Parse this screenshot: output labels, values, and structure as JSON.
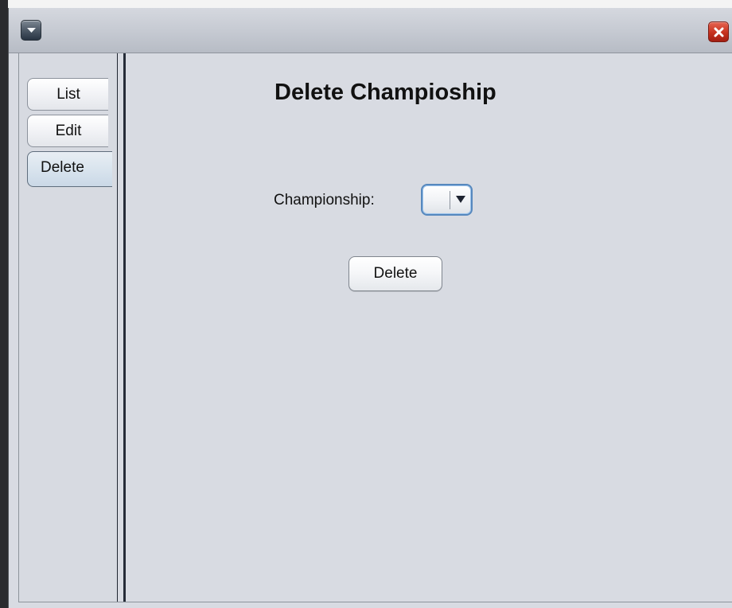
{
  "window": {
    "menu_icon": "chevron-down-icon",
    "close_icon": "close-icon"
  },
  "tabs": [
    {
      "label": "List",
      "selected": false
    },
    {
      "label": "Edit",
      "selected": false
    },
    {
      "label": "Delete",
      "selected": true
    }
  ],
  "panel": {
    "title": "Delete Champioship",
    "championship_label": "Championship:",
    "championship_value": "",
    "delete_button": "Delete"
  },
  "colors": {
    "background": "#d8dbe2",
    "close_button": "#c6321f",
    "combo_focus": "#5688be",
    "selected_tab": "#d9e4ee"
  }
}
